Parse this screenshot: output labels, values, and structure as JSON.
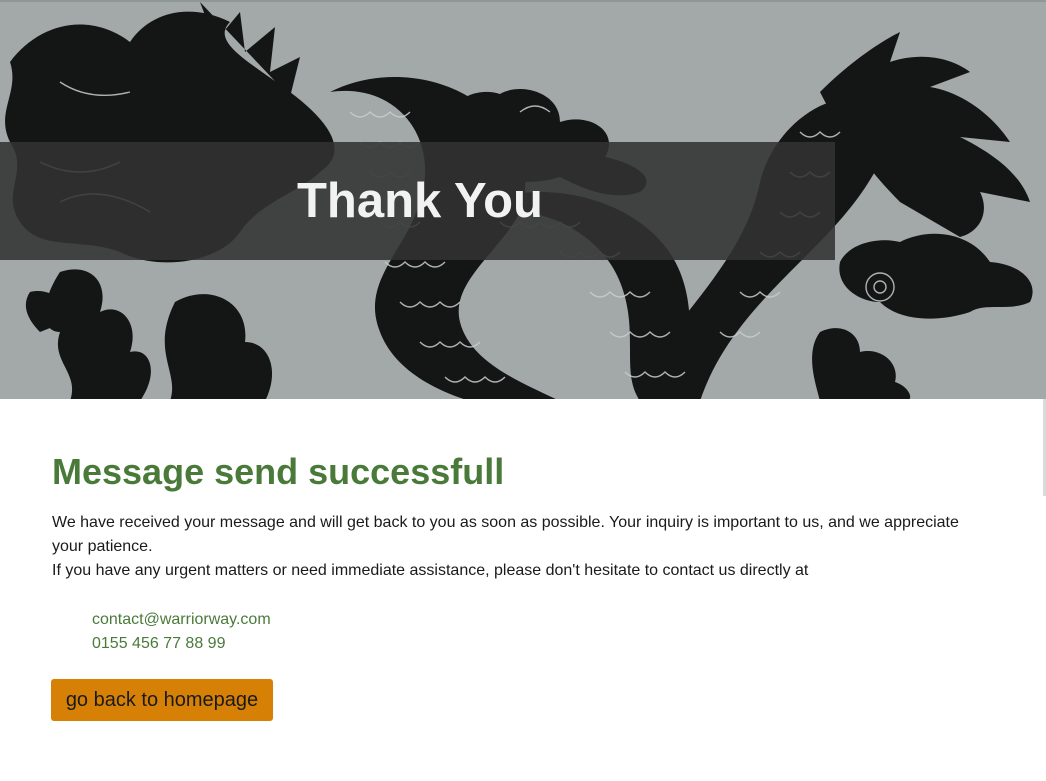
{
  "hero": {
    "title": "Thank You",
    "image_subject": "black dragon silhouette",
    "background_color": "#a3a8a8",
    "banner_color": "#323232"
  },
  "main": {
    "heading": "Message send successfull",
    "paragraph_1": "We have received your message and will get back to you as soon as possible. Your inquiry is important to us, and we appreciate your patience.",
    "paragraph_2": "If you have any urgent matters or need immediate assistance, please don't hesitate to contact us directly at",
    "contacts": {
      "email": "contact@warriorway.com",
      "phone": "0155 456 77 88 99"
    },
    "home_button_label": "go back to homepage"
  },
  "colors": {
    "accent_green": "#4a7a3a",
    "button_orange": "#d68106",
    "text": "#1a1a1a"
  }
}
